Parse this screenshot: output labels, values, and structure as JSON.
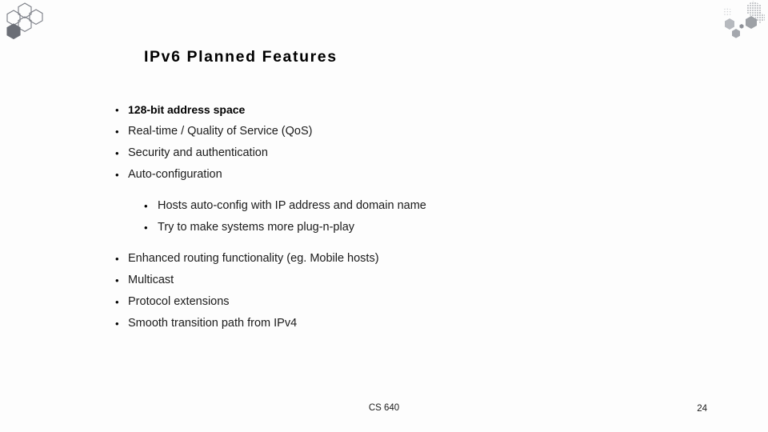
{
  "slide": {
    "title": "IPv6 Planned Features",
    "background_color": "#fdfdfd",
    "text_color": "#1a1a1a",
    "bullets": [
      {
        "level": 1,
        "text": "128-bit address space",
        "bold": true
      },
      {
        "level": 1,
        "text": "Real-time / Quality of Service (QoS)",
        "bold": false
      },
      {
        "level": 1,
        "text": "Security and authentication",
        "bold": false
      },
      {
        "level": 1,
        "text": "Auto-configuration",
        "bold": false
      },
      {
        "level": 2,
        "text": "Hosts auto-config with IP address and domain name",
        "bold": false
      },
      {
        "level": 2,
        "text": "Try to make systems more plug-n-play",
        "bold": false
      },
      {
        "level": 1,
        "text": "Enhanced routing functionality (eg. Mobile hosts)",
        "bold": false
      },
      {
        "level": 1,
        "text": "Multicast",
        "bold": false
      },
      {
        "level": 1,
        "text": "Protocol extensions",
        "bold": false
      },
      {
        "level": 1,
        "text": "Smooth transition path from IPv4",
        "bold": false
      }
    ],
    "bullet_marker": "•",
    "footer": {
      "center_text": "CS 640",
      "page_number": "24"
    },
    "decorations": {
      "top_left": "hexagon-cluster-icon",
      "top_right": "halftone-hexagon-cluster-icon",
      "outline_color": "#7a7d85",
      "fill_color": "#6b6e76"
    }
  }
}
